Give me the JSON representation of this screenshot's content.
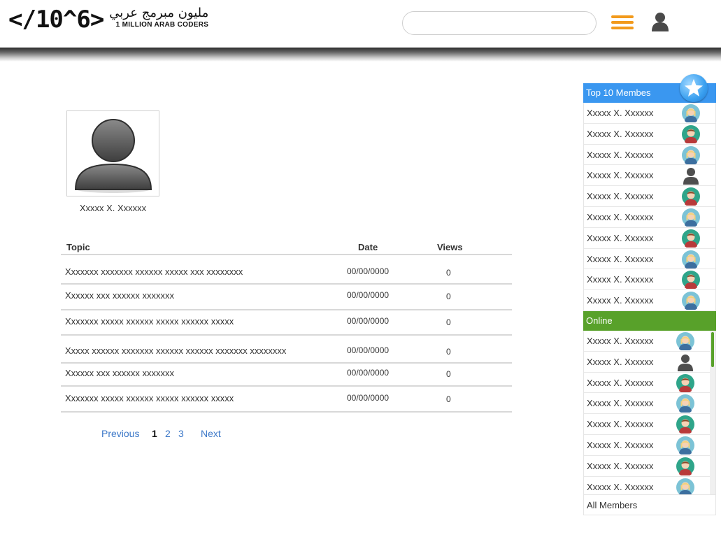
{
  "header": {
    "logo_mark": "</10^6>",
    "logo_arabic": "مليون مبرمج عربي",
    "logo_english": "1 MILLION ARAB CODERS",
    "search_placeholder": ""
  },
  "profile": {
    "name": "Xxxxx X. Xxxxxx"
  },
  "table": {
    "headers": {
      "topic": "Topic",
      "date": "Date",
      "views": "Views"
    },
    "rows": [
      {
        "topic": "Xxxxxxx xxxxxxx xxxxxx xxxxx xxx xxxxxxxx",
        "date": "00/00/0000",
        "views": "0"
      },
      {
        "topic": "Xxxxxx xxx xxxxxx xxxxxxx",
        "date": "00/00/0000",
        "views": "0"
      },
      {
        "topic": "Xxxxxxx xxxxx xxxxxx xxxxx xxxxxx xxxxx",
        "date": "00/00/0000",
        "views": "0"
      },
      {
        "topic": "Xxxxx xxxxxx xxxxxxx xxxxxx xxxxxx xxxxxxx xxxxxxxx",
        "date": "00/00/0000",
        "views": "0"
      },
      {
        "topic": "Xxxxxx xxx xxxxxx xxxxxxx",
        "date": "00/00/0000",
        "views": "0"
      },
      {
        "topic": "Xxxxxxx xxxxx xxxxxx xxxxx xxxxxx xxxxx",
        "date": "00/00/0000",
        "views": "0"
      }
    ]
  },
  "pagination": {
    "previous": "Previous",
    "pages": [
      "1",
      "2",
      "3"
    ],
    "current": "1",
    "next": "Next"
  },
  "sidebar": {
    "top_title": "Top 10 Membes",
    "top_members": [
      {
        "name": "Xxxxx X. Xxxxxx",
        "avatar": "female-avatar-icon"
      },
      {
        "name": "Xxxxx X. Xxxxxx",
        "avatar": "male-avatar-icon"
      },
      {
        "name": "Xxxxx X. Xxxxxx",
        "avatar": "female-avatar-icon"
      },
      {
        "name": "Xxxxx X. Xxxxxx",
        "avatar": "default-avatar-icon"
      },
      {
        "name": "Xxxxx X. Xxxxxx",
        "avatar": "male-avatar-icon"
      },
      {
        "name": "Xxxxx X. Xxxxxx",
        "avatar": "female-avatar-icon"
      },
      {
        "name": "Xxxxx X. Xxxxxx",
        "avatar": "male-avatar-icon"
      },
      {
        "name": "Xxxxx X. Xxxxxx",
        "avatar": "female-avatar-icon"
      },
      {
        "name": "Xxxxx X. Xxxxxx",
        "avatar": "male-avatar-icon"
      },
      {
        "name": "Xxxxx X. Xxxxxx",
        "avatar": "female-avatar-icon"
      }
    ],
    "online_title": "Online",
    "online_members": [
      {
        "name": "Xxxxx X. Xxxxxx",
        "avatar": "female-avatar-icon"
      },
      {
        "name": "Xxxxx X. Xxxxxx",
        "avatar": "default-avatar-icon"
      },
      {
        "name": "Xxxxx X. Xxxxxx",
        "avatar": "male-avatar-icon"
      },
      {
        "name": "Xxxxx X. Xxxxxx",
        "avatar": "female-avatar-icon"
      },
      {
        "name": "Xxxxx X. Xxxxxx",
        "avatar": "male-avatar-icon"
      },
      {
        "name": "Xxxxx X. Xxxxxx",
        "avatar": "female-avatar-icon"
      },
      {
        "name": "Xxxxx X. Xxxxxx",
        "avatar": "male-avatar-icon"
      },
      {
        "name": "Xxxxx X. Xxxxxx",
        "avatar": "female-avatar-icon"
      }
    ],
    "all_members": "All Members"
  },
  "colors": {
    "top_header": "#3a97f0",
    "online_header": "#58a12a",
    "menu_accent": "#f29a1c",
    "link": "#3c78c8"
  }
}
